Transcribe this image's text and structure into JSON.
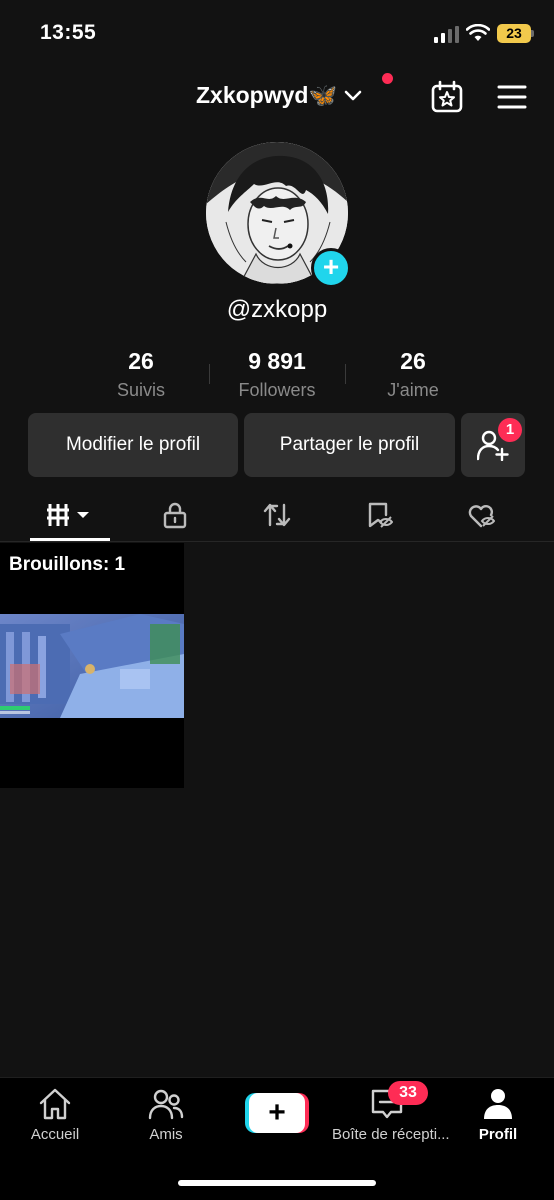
{
  "status_bar": {
    "time": "13:55",
    "battery": "23",
    "icons": [
      "signal-icon",
      "wifi-icon",
      "battery-icon"
    ]
  },
  "header": {
    "username": "Zxkopwyd🦋",
    "icons": [
      "chevron-down-icon",
      "calendar-star-icon",
      "menu-icon"
    ]
  },
  "profile": {
    "handle": "@zxkopp",
    "stats": [
      {
        "value": "26",
        "label": "Suivis"
      },
      {
        "value": "9 891",
        "label": "Followers"
      },
      {
        "value": "26",
        "label": "J'aime"
      }
    ],
    "edit_button": "Modifier le profil",
    "share_button": "Partager le profil",
    "add_friend_badge": "1"
  },
  "tabs": [
    {
      "icon": "videos-grid-icon",
      "active": true
    },
    {
      "icon": "lock-icon",
      "active": false
    },
    {
      "icon": "repost-icon",
      "active": false
    },
    {
      "icon": "hidden-bookmark-icon",
      "active": false
    },
    {
      "icon": "hidden-heart-icon",
      "active": false
    }
  ],
  "drafts": {
    "label": "Brouillons: 1"
  },
  "bottom_nav": {
    "items": [
      {
        "label": "Accueil",
        "icon": "home-icon"
      },
      {
        "label": "Amis",
        "icon": "friends-icon"
      },
      {
        "label": "",
        "icon": "create-plus-icon"
      },
      {
        "label": "Boîte de récepti...",
        "icon": "inbox-icon"
      },
      {
        "label": "Profil",
        "icon": "profile-icon"
      }
    ],
    "inbox_badge": "33"
  },
  "colors": {
    "background": "#121212",
    "accent_pink": "#fe2c55",
    "accent_cyan": "#20d5ec",
    "button_bg": "#2f2f2f",
    "battery_yellow": "#f2c94c"
  }
}
